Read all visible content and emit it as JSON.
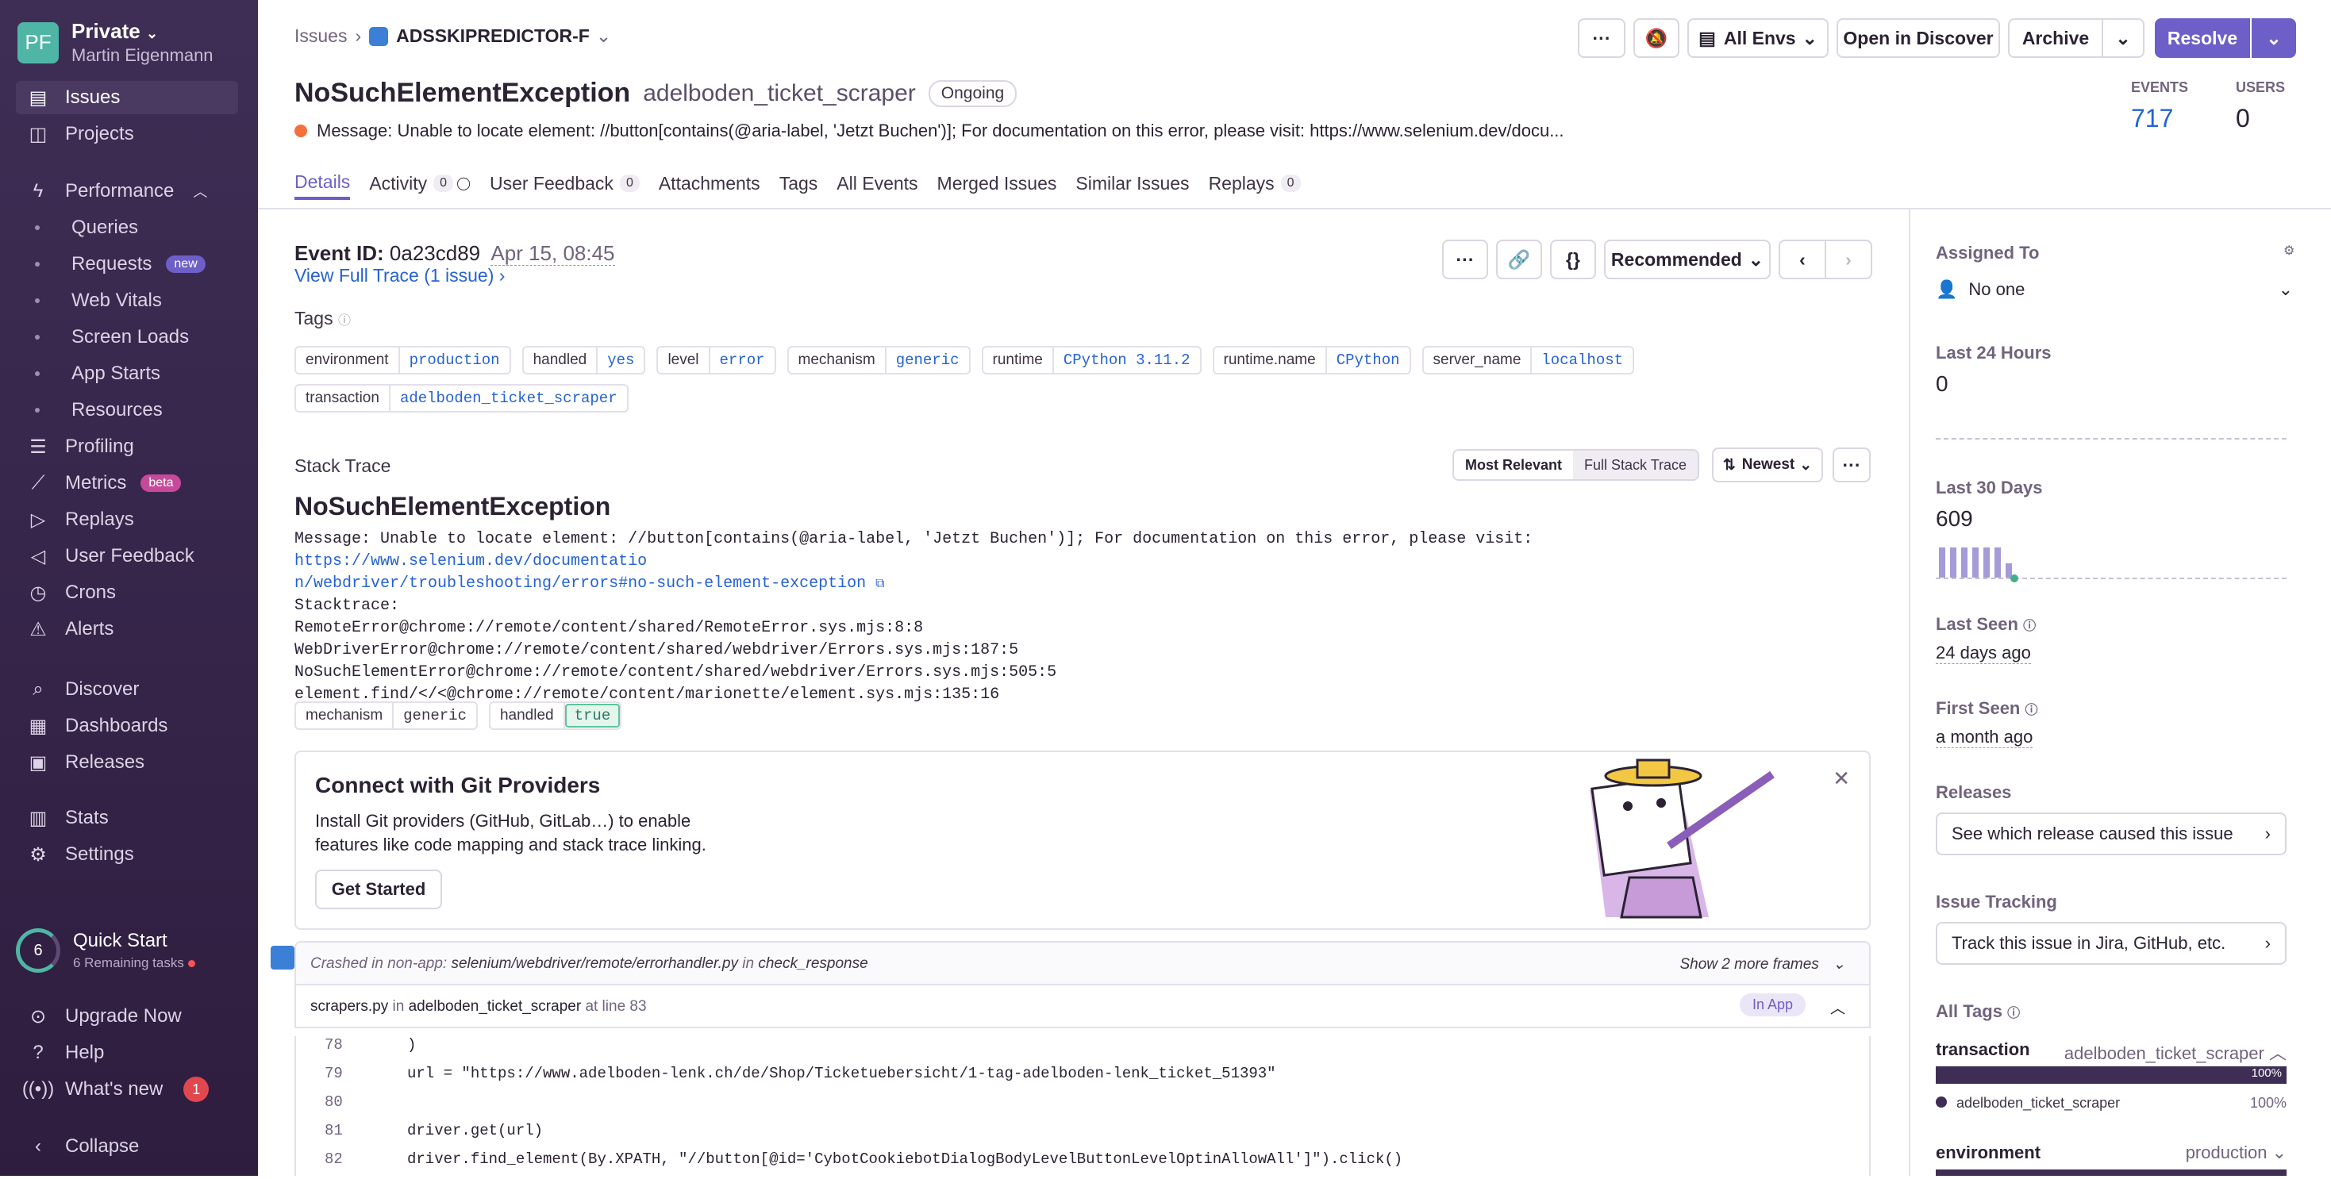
{
  "org": {
    "initials": "PF",
    "name": "Private",
    "user": "Martin Eigenmann"
  },
  "nav": {
    "issues": "Issues",
    "projects": "Projects",
    "performance": "Performance",
    "queries": "Queries",
    "requests": "Requests",
    "requests_badge": "new",
    "web_vitals": "Web Vitals",
    "screen_loads": "Screen Loads",
    "app_starts": "App Starts",
    "resources": "Resources",
    "profiling": "Profiling",
    "metrics": "Metrics",
    "metrics_badge": "beta",
    "replays": "Replays",
    "user_feedback": "User Feedback",
    "crons": "Crons",
    "alerts": "Alerts",
    "discover": "Discover",
    "dashboards": "Dashboards",
    "releases": "Releases",
    "stats": "Stats",
    "settings": "Settings",
    "quick_start": "Quick Start",
    "quick_start_sub": "6 Remaining tasks",
    "quick_start_count": "6",
    "upgrade": "Upgrade Now",
    "help": "Help",
    "whats_new": "What's new",
    "whats_new_count": "1",
    "collapse": "Collapse"
  },
  "header": {
    "crumb_root": "Issues",
    "crumb_project": "ADSSKIPREDICTOR-F",
    "btn_more": "···",
    "btn_envs": "All Envs",
    "btn_discover": "Open in Discover",
    "btn_archive": "Archive",
    "btn_resolve": "Resolve",
    "title": "NoSuchElementException",
    "culprit": "adelboden_ticket_scraper",
    "status": "Ongoing",
    "message": "Message: Unable to locate element: //button[contains(@aria-label, 'Jetzt Buchen')]; For documentation on this error, please visit: https://www.selenium.dev/docu...",
    "events_label": "EVENTS",
    "events_value": "717",
    "users_label": "USERS",
    "users_value": "0"
  },
  "tabs": [
    {
      "label": "Details"
    },
    {
      "label": "Activity",
      "count": "0"
    },
    {
      "label": "User Feedback",
      "count": "0"
    },
    {
      "label": "Attachments"
    },
    {
      "label": "Tags"
    },
    {
      "label": "All Events"
    },
    {
      "label": "Merged Issues"
    },
    {
      "label": "Similar Issues"
    },
    {
      "label": "Replays",
      "count": "0"
    }
  ],
  "event": {
    "id_label": "Event ID:",
    "id": "0a23cd89",
    "date": "Apr 15, 08:45",
    "view_trace": "View Full Trace (1 issue)",
    "recommended": "Recommended",
    "tags_label": "Tags",
    "tags": [
      {
        "k": "environment",
        "v": "production"
      },
      {
        "k": "handled",
        "v": "yes"
      },
      {
        "k": "level",
        "v": "error"
      },
      {
        "k": "mechanism",
        "v": "generic"
      },
      {
        "k": "runtime",
        "v": "CPython 3.11.2"
      },
      {
        "k": "runtime.name",
        "v": "CPython"
      },
      {
        "k": "server_name",
        "v": "localhost"
      },
      {
        "k": "transaction",
        "v": "adelboden_ticket_scraper"
      }
    ],
    "stack_label": "Stack Trace",
    "most_relevant": "Most Relevant",
    "full_trace": "Full Stack Trace",
    "newest": "Newest",
    "exception": "NoSuchElementException",
    "msg_prefix": "Message: Unable to locate element: //button[contains(@aria-label, 'Jetzt Buchen')]; For documentation on this error, please visit: ",
    "msg_link_1": "https://www.selenium.dev/documentatio",
    "msg_link_2": "n/webdriver/troubleshooting/errors#no-such-element-exception",
    "trace_lines": [
      "Stacktrace:",
      "RemoteError@chrome://remote/content/shared/RemoteError.sys.mjs:8:8",
      "WebDriverError@chrome://remote/content/shared/webdriver/Errors.sys.mjs:187:5",
      "NoSuchElementError@chrome://remote/content/shared/webdriver/Errors.sys.mjs:505:5",
      "element.find/</<@chrome://remote/content/marionette/element.sys.mjs:135:16"
    ],
    "mech_k": "mechanism",
    "mech_v": "generic",
    "handled_k": "handled",
    "handled_v": "true"
  },
  "git": {
    "title": "Connect with Git Providers",
    "body": "Install Git providers (GitHub, GitLab…) to enable features like code mapping and stack trace linking.",
    "button": "Get Started"
  },
  "frames": {
    "crashed_prefix": "Crashed in non-app:",
    "crashed_path": "selenium/webdriver/remote/errorhandler.py",
    "crashed_in": "in",
    "crashed_fn": "check_response",
    "show_more": "Show 2 more frames",
    "file": "scrapers.py",
    "file_in": "in",
    "file_fn": "adelboden_ticket_scraper",
    "file_line": "at line 83",
    "in_app": "In App"
  },
  "code": [
    {
      "n": "78",
      "t": ")"
    },
    {
      "n": "79",
      "t": "url = \"https://www.adelboden-lenk.ch/de/Shop/Ticketuebersicht/1-tag-adelboden-lenk_ticket_51393\""
    },
    {
      "n": "80",
      "t": ""
    },
    {
      "n": "81",
      "t": "driver.get(url)"
    },
    {
      "n": "82",
      "t": "driver.find_element(By.XPATH, \"//button[@id='CybotCookiebotDialogBodyLevelButtonLevelOptinAllowAll']\").click()"
    }
  ],
  "right": {
    "assigned_label": "Assigned To",
    "assigned_value": "No one",
    "last24_label": "Last 24 Hours",
    "last24_value": "0",
    "last30_label": "Last 30 Days",
    "last30_value": "609",
    "last_seen_label": "Last Seen",
    "last_seen_value": "24 days ago",
    "first_seen_label": "First Seen",
    "first_seen_value": "a month ago",
    "releases_label": "Releases",
    "releases_btn": "See which release caused this issue",
    "tracking_label": "Issue Tracking",
    "tracking_btn": "Track this issue in Jira, GitHub, etc.",
    "all_tags_label": "All Tags",
    "tag1_key": "transaction",
    "tag1_val": "adelboden_ticket_scraper",
    "tag1_pct": "100%",
    "tag1_item": "adelboden_ticket_scraper",
    "tag1_item_pct": "100%",
    "tag2_key": "environment",
    "tag2_val": "production"
  },
  "colors": {
    "accent": "#6c5fc7",
    "sidebar": "#3e2e55",
    "link": "#2562d4"
  }
}
